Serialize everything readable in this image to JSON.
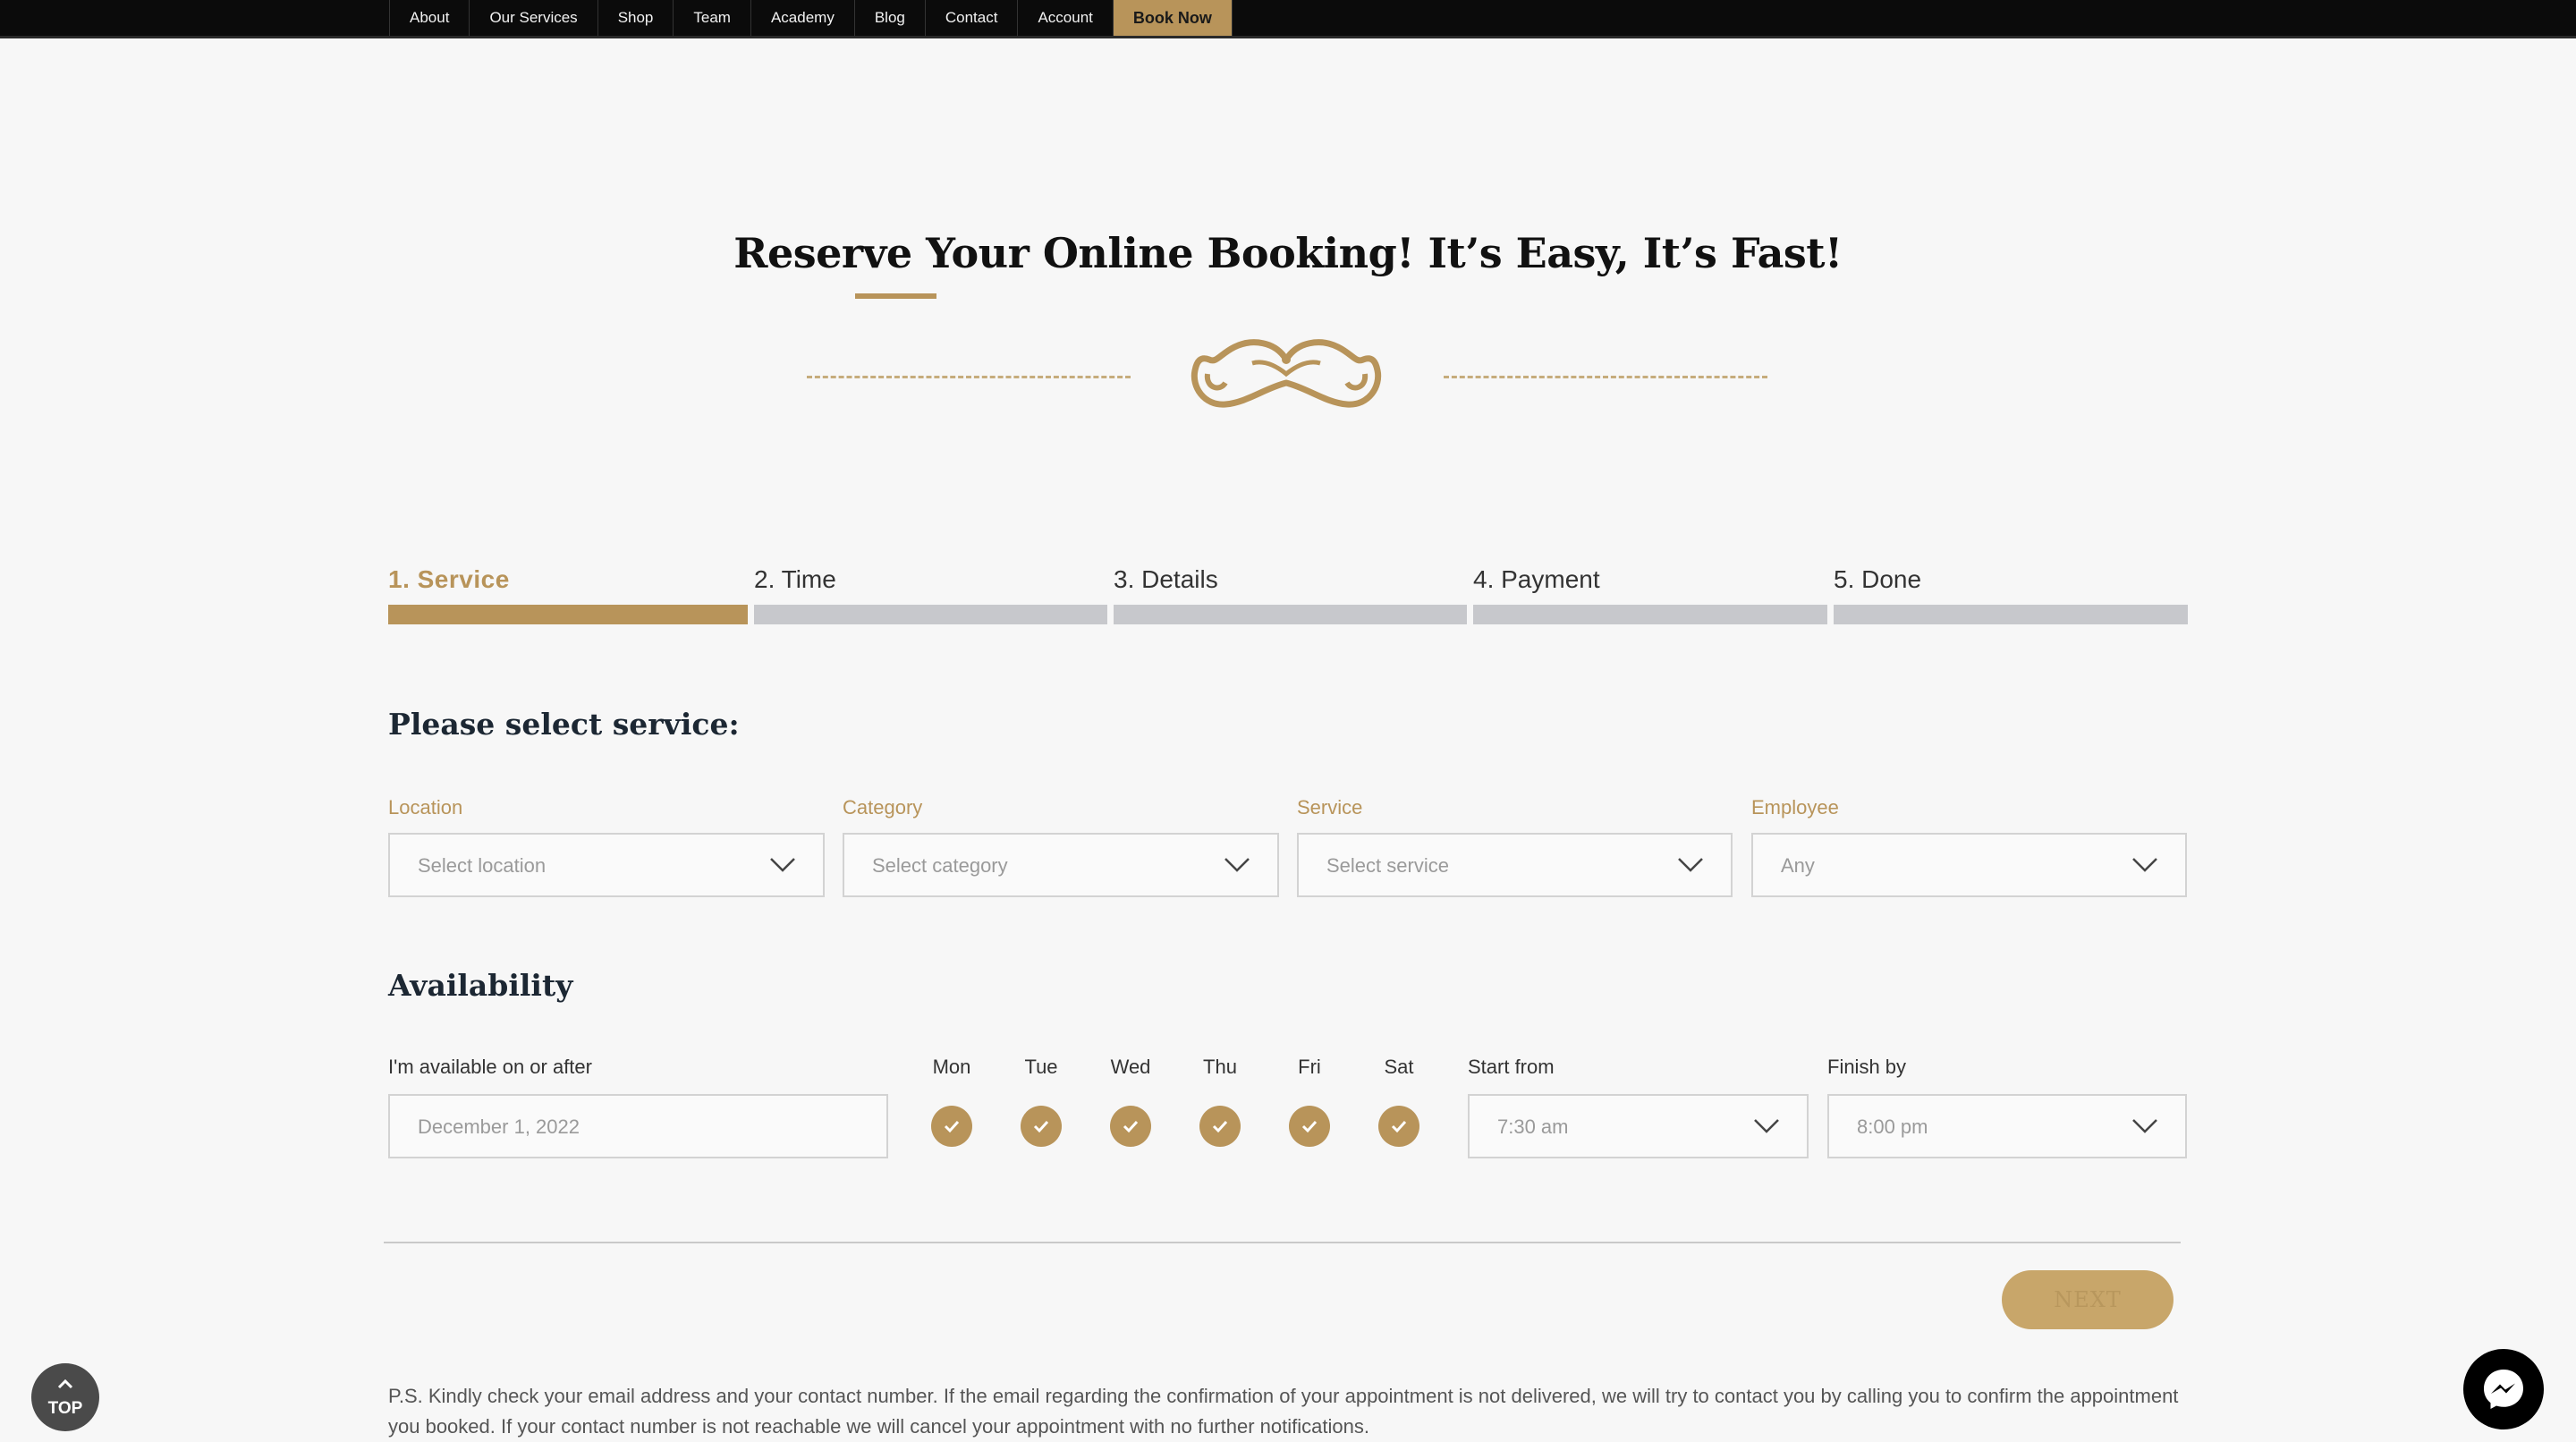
{
  "nav": {
    "items": [
      "About",
      "Our Services",
      "Shop",
      "Team",
      "Academy",
      "Blog",
      "Contact",
      "Account"
    ],
    "book_now": "Book Now"
  },
  "title": "Reserve Your Online Booking! It’s Easy, It’s Fast!",
  "steps": [
    {
      "label": "1. Service",
      "active": true
    },
    {
      "label": "2. Time",
      "active": false
    },
    {
      "label": "3. Details",
      "active": false
    },
    {
      "label": "4. Payment",
      "active": false
    },
    {
      "label": "5. Done",
      "active": false
    }
  ],
  "service_section": {
    "title": "Please select service:",
    "location_label": "Location",
    "location_value": "Select location",
    "category_label": "Category",
    "category_value": "Select category",
    "service_label": "Service",
    "service_value": "Select service",
    "employee_label": "Employee",
    "employee_value": "Any"
  },
  "availability": {
    "title": "Availability",
    "date_label": "I'm available on or after",
    "date_value": "December 1, 2022",
    "days": [
      "Mon",
      "Tue",
      "Wed",
      "Thu",
      "Fri",
      "Sat"
    ],
    "start_label": "Start from",
    "start_value": "7:30 am",
    "finish_label": "Finish by",
    "finish_value": "8:00 pm"
  },
  "next_label": "NEXT",
  "note": "P.S. Kindly check your email address and your contact number. If the email regarding the confirmation of your appointment is not delivered, we will try to contact you by calling you to confirm the appointment you booked. If your contact number is not reachable we will cancel your appointment with no further notifications.",
  "top_button": "TOP",
  "colors": {
    "accent": "#b8945a",
    "nav_bg": "#0b0b0b",
    "inactive_step": "#c7c8cc"
  },
  "icons": {
    "mustache": "mustache-icon",
    "chevron": "chevron-down-icon",
    "check": "check-icon",
    "messenger": "messenger-icon"
  }
}
